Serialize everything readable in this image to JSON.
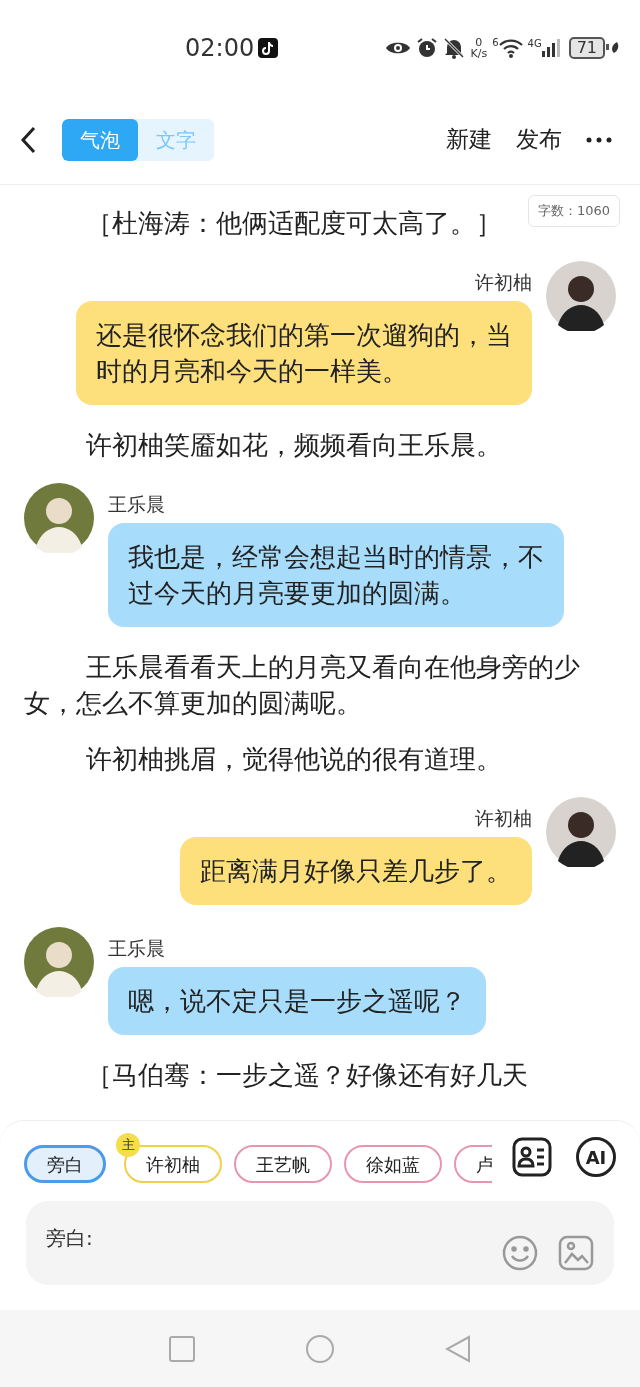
{
  "status_bar": {
    "time": "02:00",
    "speed_value": "0",
    "speed_unit": "K/s",
    "wifi_label": "6",
    "network": "4G",
    "battery": "71"
  },
  "header": {
    "tabs": [
      {
        "label": "气泡",
        "selected": true
      },
      {
        "label": "文字",
        "selected": false
      }
    ],
    "actions": [
      "新建",
      "发布"
    ]
  },
  "word_count": "字数：1060",
  "story": [
    {
      "kind": "narration",
      "text": "［杜海涛：他俩适配度可太高了。］"
    },
    {
      "kind": "right_message",
      "name": "许初柚",
      "text": "还是很怀念我们的第一次遛狗的，当时的月亮和今天的一样美。"
    },
    {
      "kind": "narration",
      "text": "许初柚笑靥如花，频频看向王乐晨。"
    },
    {
      "kind": "left_message",
      "name": "王乐晨",
      "text": "我也是，经常会想起当时的情景，不过今天的月亮要更加的圆满。"
    },
    {
      "kind": "narration",
      "text": "王乐晨看看天上的月亮又看向在他身旁的少女，怎么不算更加的圆满呢。"
    },
    {
      "kind": "narration",
      "text": "许初柚挑眉，觉得他说的很有道理。"
    },
    {
      "kind": "right_message",
      "name": "许初柚",
      "text": "距离满月好像只差几步了。"
    },
    {
      "kind": "left_message",
      "name": "王乐晨",
      "text": "嗯，说不定只是一步之遥呢？"
    },
    {
      "kind": "narration",
      "text": "［马伯骞：一步之遥？好像还有好几天"
    }
  ],
  "characters": [
    {
      "name": "旁白",
      "selected": true,
      "color": "#4a9be8"
    },
    {
      "name": "许初柚",
      "selected": false,
      "color": "#f2cf4a",
      "badge": "主"
    },
    {
      "name": "王艺帆",
      "selected": false,
      "color": "#e896ae"
    },
    {
      "name": "徐如蓝",
      "selected": false,
      "color": "#e896ae"
    },
    {
      "name": "卢",
      "selected": false,
      "color": "#e896ae"
    }
  ],
  "ai_button": "AI",
  "input": {
    "prefix": "旁白:"
  }
}
